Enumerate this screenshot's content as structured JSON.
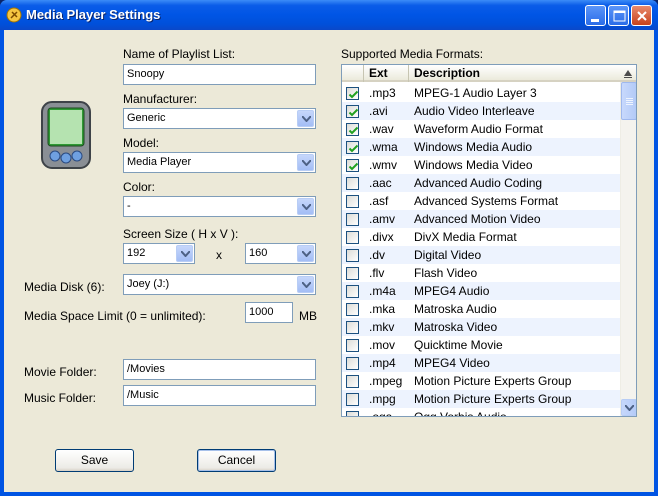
{
  "window": {
    "title": "Media Player Settings"
  },
  "form": {
    "playlist_label": "Name of Playlist List:",
    "playlist_value": "Snoopy",
    "manufacturer_label": "Manufacturer:",
    "manufacturer_value": "Generic",
    "model_label": "Model:",
    "model_value": "Media Player",
    "color_label": "Color:",
    "color_value": "-",
    "screen_size_label": "Screen Size ( H x V ):",
    "screen_h_value": "192",
    "screen_x": "x",
    "screen_v_value": "160",
    "media_disk_label": "Media Disk (6):",
    "media_disk_value": "Joey (J:)",
    "space_limit_label": "Media Space Limit (0 = unlimited):",
    "space_limit_value": "1000",
    "space_limit_unit": "MB",
    "movie_folder_label": "Movie Folder:",
    "movie_folder_value": "/Movies",
    "music_folder_label": "Music Folder:",
    "music_folder_value": "/Music"
  },
  "formats": {
    "label": "Supported Media Formats:",
    "col_ext": "Ext",
    "col_desc": "Description",
    "rows": [
      {
        "ext": ".mp3",
        "desc": "MPEG-1 Audio Layer 3",
        "checked": true
      },
      {
        "ext": ".avi",
        "desc": "Audio Video Interleave",
        "checked": true
      },
      {
        "ext": ".wav",
        "desc": "Waveform Audio Format",
        "checked": true
      },
      {
        "ext": ".wma",
        "desc": "Windows Media Audio",
        "checked": true
      },
      {
        "ext": ".wmv",
        "desc": "Windows Media Video",
        "checked": true
      },
      {
        "ext": ".aac",
        "desc": "Advanced Audio Coding",
        "checked": false
      },
      {
        "ext": ".asf",
        "desc": "Advanced Systems Format",
        "checked": false
      },
      {
        "ext": ".amv",
        "desc": "Advanced Motion Video",
        "checked": false
      },
      {
        "ext": ".divx",
        "desc": "DivX Media Format",
        "checked": false
      },
      {
        "ext": ".dv",
        "desc": "Digital Video",
        "checked": false
      },
      {
        "ext": ".flv",
        "desc": "Flash Video",
        "checked": false
      },
      {
        "ext": ".m4a",
        "desc": "MPEG4 Audio",
        "checked": false
      },
      {
        "ext": ".mka",
        "desc": "Matroska Audio",
        "checked": false
      },
      {
        "ext": ".mkv",
        "desc": "Matroska Video",
        "checked": false
      },
      {
        "ext": ".mov",
        "desc": "Quicktime Movie",
        "checked": false
      },
      {
        "ext": ".mp4",
        "desc": "MPEG4 Video",
        "checked": false
      },
      {
        "ext": ".mpeg",
        "desc": "Motion Picture Experts Group",
        "checked": false
      },
      {
        "ext": ".mpg",
        "desc": "Motion Picture Experts Group",
        "checked": false
      },
      {
        "ext": ".oga",
        "desc": "Ogg Vorbis Audio",
        "checked": false
      }
    ]
  },
  "buttons": {
    "save": "Save",
    "cancel": "Cancel"
  },
  "icons": {
    "app": "media-player-app-icon",
    "device": "pda-device-icon",
    "minimize": "minimize-icon",
    "maximize": "maximize-icon",
    "close": "close-icon"
  }
}
